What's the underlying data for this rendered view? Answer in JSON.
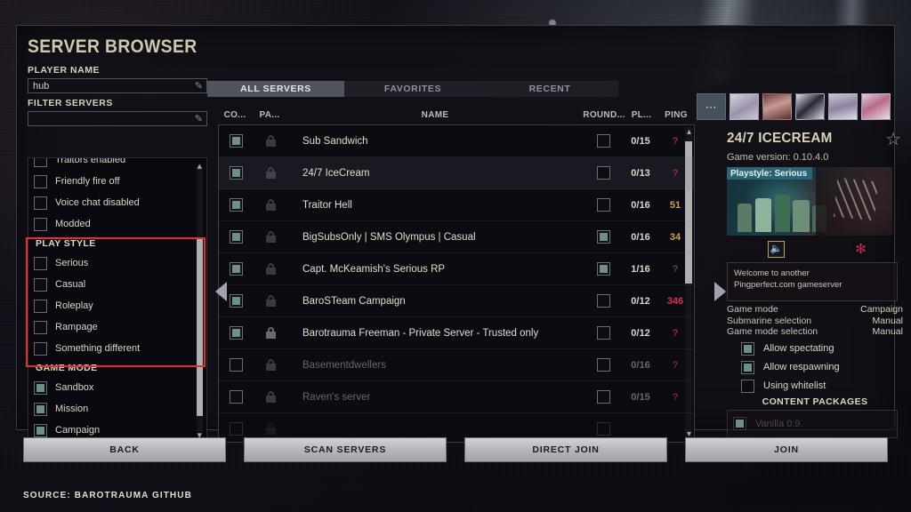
{
  "window": {
    "title": "SERVER BROWSER",
    "source_caption": "SOURCE:  BAROTRAUMA GITHUB"
  },
  "left_panel": {
    "player_name_label": "PLAYER NAME",
    "player_name_value": "hub",
    "filter_servers_label": "FILTER SERVERS",
    "filter_servers_value": "",
    "edit_icon": "pencil-icon",
    "filters": [
      {
        "label": "Traitors enabled",
        "checked": false,
        "partial": true
      },
      {
        "label": "Friendly fire off",
        "checked": false
      },
      {
        "label": "Voice chat disabled",
        "checked": false
      },
      {
        "label": "Modded",
        "checked": false
      }
    ],
    "play_style": {
      "heading": "PLAY STYLE",
      "items": [
        {
          "label": "Serious",
          "checked": false
        },
        {
          "label": "Casual",
          "checked": false
        },
        {
          "label": "Roleplay",
          "checked": false
        },
        {
          "label": "Rampage",
          "checked": false
        },
        {
          "label": "Something different",
          "checked": false
        }
      ]
    },
    "game_mode": {
      "heading": "GAME MODE",
      "items": [
        {
          "label": "Sandbox",
          "checked": true
        },
        {
          "label": "Mission",
          "checked": true
        },
        {
          "label": "Campaign",
          "checked": true
        }
      ]
    },
    "highlight_color": "#e03030"
  },
  "tabs": [
    {
      "label": "ALL SERVERS",
      "active": true
    },
    {
      "label": "FAVORITES",
      "active": false
    },
    {
      "label": "RECENT",
      "active": false
    }
  ],
  "table": {
    "columns": [
      "CO...",
      "PA...",
      "NAME",
      "ROUND...",
      "PL...",
      "PING"
    ],
    "rows": [
      {
        "compatible": true,
        "locked": false,
        "name": "Sub Sandwich",
        "round": false,
        "players": "0/15",
        "ping": "?",
        "ping_state": "unknown",
        "dim": false
      },
      {
        "compatible": true,
        "locked": false,
        "name": "24/7 IceCream",
        "round": false,
        "players": "0/13",
        "ping": "?",
        "ping_state": "unknown",
        "dim": false,
        "selected": true
      },
      {
        "compatible": true,
        "locked": false,
        "name": "Traitor Hell",
        "round": false,
        "players": "0/16",
        "ping": "51",
        "ping_state": "good",
        "dim": false
      },
      {
        "compatible": true,
        "locked": false,
        "name": "BigSubsOnly | SMS Olympus | Casual",
        "round": true,
        "players": "0/16",
        "ping": "34",
        "ping_state": "good",
        "dim": false
      },
      {
        "compatible": true,
        "locked": false,
        "name": "Capt. McKeamish's Serious RP",
        "round": true,
        "players": "1/16",
        "ping": "?",
        "ping_state": "faint",
        "dim": false
      },
      {
        "compatible": true,
        "locked": false,
        "name": "BaroSTeam Campaign",
        "round": false,
        "players": "0/12",
        "ping": "346",
        "ping_state": "bad",
        "dim": false
      },
      {
        "compatible": true,
        "locked": true,
        "name": "Barotrauma Freeman - Private Server - Trusted only",
        "round": false,
        "players": "0/12",
        "ping": "?",
        "ping_state": "unknown",
        "dim": false
      },
      {
        "compatible": false,
        "locked": false,
        "name": "Basementdwellers",
        "round": false,
        "players": "0/16",
        "ping": "?",
        "ping_state": "unknown",
        "dim": true
      },
      {
        "compatible": false,
        "locked": false,
        "name": "Raven's server",
        "round": false,
        "players": "0/15",
        "ping": "?",
        "ping_state": "unknown",
        "dim": true
      }
    ],
    "ping_colors": {
      "good": "#caa050",
      "bad": "#d8304a",
      "unknown": "#9e2f3e",
      "faint": "#5a4a52"
    }
  },
  "details": {
    "server_name": "24/7 ICECREAM",
    "favorite_icon": "star-icon",
    "game_version_label": "Game version: 0.10.4.0",
    "playstyle_badge": "Playstyle: Serious",
    "voice_icon": "voice-chat-icon",
    "traitor_icon": "traitor-icon",
    "description_lines": [
      "Welcome to another",
      "Pingperfect.com gameserver"
    ],
    "info": [
      {
        "key": "Game mode",
        "value": "Campaign"
      },
      {
        "key": "Submarine selection",
        "value": "Manual"
      },
      {
        "key": "Game mode selection",
        "value": "Manual"
      }
    ],
    "options": [
      {
        "label": "Allow spectating",
        "checked": true
      },
      {
        "label": "Allow respawning",
        "checked": true
      },
      {
        "label": "Using whitelist",
        "checked": false
      }
    ],
    "content_packages_heading": "CONTENT PACKAGES",
    "content_packages": [
      {
        "label": "Vanilla 0.9.",
        "checked": true
      }
    ],
    "thumbnails_more_icon": "ellipsis-icon"
  },
  "footer_buttons": [
    {
      "label": "BACK"
    },
    {
      "label": "SCAN SERVERS"
    },
    {
      "label": "DIRECT JOIN"
    },
    {
      "label": "JOIN"
    }
  ],
  "nav": {
    "left_arrow_icon": "chevron-left-icon",
    "right_arrow_icon": "chevron-right-icon",
    "scroll_up_icon": "chevron-up-icon",
    "scroll_down_icon": "chevron-down-icon"
  }
}
